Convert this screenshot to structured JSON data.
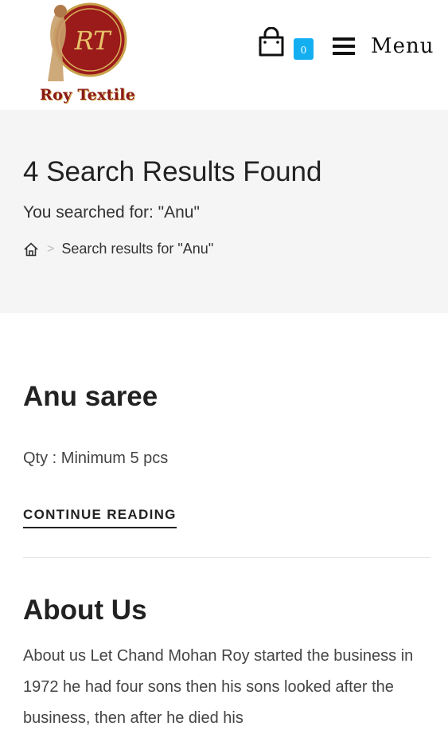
{
  "header": {
    "logo_text": "Roy Textile",
    "cart_count": "0",
    "menu_label": "Menu",
    "icons": [
      "shopping-bag-icon",
      "hamburger-icon"
    ],
    "accent_color": "#13aff0"
  },
  "hero": {
    "title": "4 Search Results Found",
    "subtitle": "You searched for: \"Anu\"",
    "breadcrumb": {
      "separator": ">",
      "current": "Search results for \"Anu\""
    },
    "background": "#f5f5f5"
  },
  "results": [
    {
      "title": "Anu saree",
      "excerpt": "Qty : Minimum 5 pcs",
      "link": "CONTINUE READING"
    },
    {
      "title": "About Us",
      "excerpt": "About us Let Chand Mohan Roy started the business in 1972 he had four sons then his sons looked after the business, then after he died his"
    }
  ]
}
